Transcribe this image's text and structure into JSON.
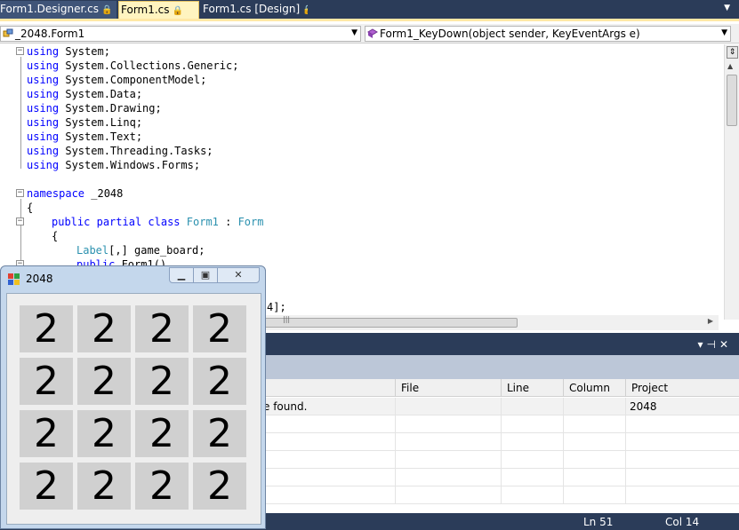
{
  "tabs": [
    {
      "label": "Form1.Designer.cs",
      "locked": true,
      "active": false
    },
    {
      "label": "Form1.cs",
      "locked": true,
      "active": true
    },
    {
      "label": "Form1.cs [Design]",
      "locked": true,
      "active": false
    }
  ],
  "nav": {
    "class_combo": "_2048.Form1",
    "member_combo": "Form1_KeyDown(object sender, KeyEventArgs e)"
  },
  "code": {
    "lines": [
      {
        "kw": "using",
        "rest": " System;"
      },
      {
        "kw": "using",
        "rest": " System.Collections.Generic;"
      },
      {
        "kw": "using",
        "rest": " System.ComponentModel;"
      },
      {
        "kw": "using",
        "rest": " System.Data;"
      },
      {
        "kw": "using",
        "rest": " System.Drawing;"
      },
      {
        "kw": "using",
        "rest": " System.Linq;"
      },
      {
        "kw": "using",
        "rest": " System.Text;"
      },
      {
        "kw": "using",
        "rest": " System.Threading.Tasks;"
      },
      {
        "kw": "using",
        "rest": " System.Windows.Forms;"
      }
    ],
    "namespace_kw": "namespace",
    "namespace_name": " _2048",
    "open_brace": "{",
    "class_kw1": "public",
    "class_kw2": "partial",
    "class_kw3": "class",
    "class_name": "Form1",
    "class_sep": " : ",
    "class_base": "Form",
    "class_brace": "{",
    "field_type": "Label",
    "field_rest": "[,] game_board;",
    "ctor_kw": "public",
    "ctor_name": " Form1()",
    "partial_tail": "4];"
  },
  "error_list": {
    "columns": [
      "File",
      "Line",
      "Column",
      "Project"
    ],
    "rows": [
      {
        "description": "e found.",
        "file": "",
        "line": "",
        "column": "",
        "project": "2048"
      }
    ]
  },
  "status": {
    "ln": "Ln 51",
    "col": "Col 14"
  },
  "game_window": {
    "title": "2048",
    "tiles": [
      "2",
      "2",
      "2",
      "2",
      "2",
      "2",
      "2",
      "2",
      "2",
      "2",
      "2",
      "2",
      "2",
      "2",
      "2",
      "2"
    ]
  }
}
